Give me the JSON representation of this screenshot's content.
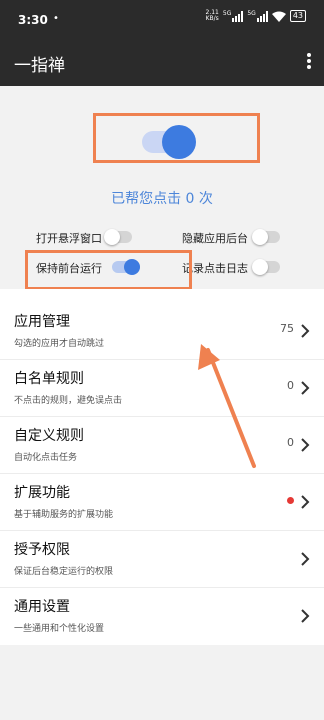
{
  "status_bar": {
    "time": "3:30",
    "indicator": "•",
    "net_speed_value": "2.11",
    "net_speed_unit": "KB/s",
    "signal_1_label": "5G",
    "signal_2_label": "5G",
    "battery": "43"
  },
  "app_bar": {
    "title": "一指禅",
    "menu_icon": "more-vertical-icon"
  },
  "main_switch": {
    "on": true
  },
  "click_count_text": "已帮您点击 0 次",
  "options": {
    "floating_window": {
      "label": "打开悬浮窗口",
      "on": false
    },
    "hide_recents": {
      "label": "隐藏应用后台",
      "on": false
    },
    "keep_foreground": {
      "label": "保持前台运行",
      "on": true
    },
    "record_log": {
      "label": "记录点击日志",
      "on": false
    }
  },
  "menu": {
    "items": [
      {
        "title": "应用管理",
        "subtitle": "勾选的应用才自动跳过",
        "value": "75"
      },
      {
        "title": "白名单规则",
        "subtitle": "不点击的规则，避免误点击",
        "value": "0"
      },
      {
        "title": "自定义规则",
        "subtitle": "自动化点击任务",
        "value": "0"
      },
      {
        "title": "扩展功能",
        "subtitle": "基于辅助服务的扩展功能",
        "badge": "red-dot"
      },
      {
        "title": "授予权限",
        "subtitle": "保证后台稳定运行的权限"
      },
      {
        "title": "通用设置",
        "subtitle": "一些通用和个性化设置"
      }
    ]
  },
  "colors": {
    "accent": "#3d7be0",
    "highlight_annotation": "#ef8150",
    "app_bar": "#2b2b2b"
  }
}
